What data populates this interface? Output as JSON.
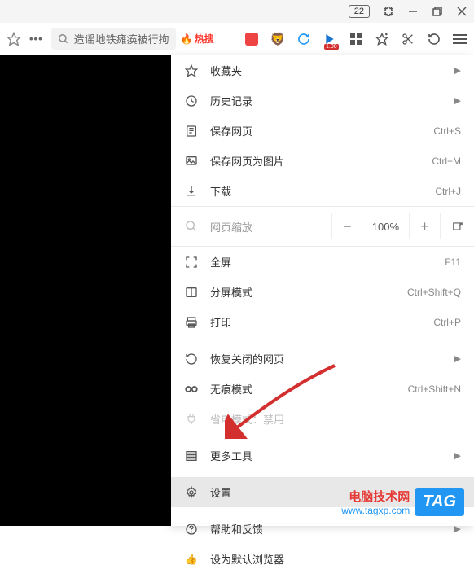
{
  "window": {
    "tab_count": "22"
  },
  "toolbar": {
    "search_text": "造谣地铁瘫痪被行拘",
    "hot_label": "热搜"
  },
  "menu": {
    "favorites": "收藏夹",
    "history": "历史记录",
    "save_page": "保存网页",
    "save_page_shortcut": "Ctrl+S",
    "save_as_image": "保存网页为图片",
    "save_as_image_shortcut": "Ctrl+M",
    "downloads": "下载",
    "downloads_shortcut": "Ctrl+J",
    "zoom_label": "网页缩放",
    "zoom_value": "100%",
    "fullscreen": "全屏",
    "fullscreen_shortcut": "F11",
    "split_screen": "分屏模式",
    "split_screen_shortcut": "Ctrl+Shift+Q",
    "print": "打印",
    "print_shortcut": "Ctrl+P",
    "restore_closed": "恢复关闭的网页",
    "incognito": "无痕模式",
    "incognito_shortcut": "Ctrl+Shift+N",
    "power_save": "省电模式：禁用",
    "more_tools": "更多工具",
    "settings": "设置",
    "help": "帮助和反馈",
    "set_default": "设为默认浏览器"
  },
  "watermark": {
    "title": "电脑技术网",
    "url": "www.tagxp.com",
    "tag": "TAG"
  }
}
